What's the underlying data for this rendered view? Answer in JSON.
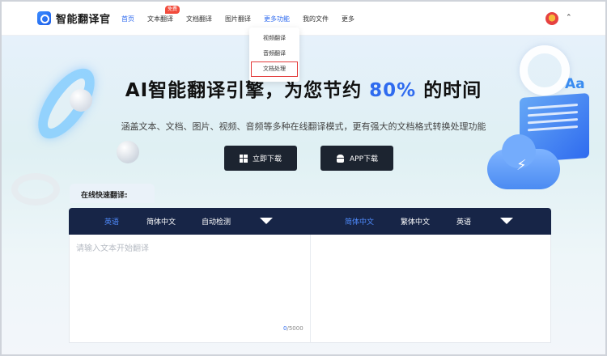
{
  "header": {
    "logo_text": "智能翻译官",
    "nav": [
      {
        "label": "首页"
      },
      {
        "label": "文本翻译",
        "badge": "免费"
      },
      {
        "label": "文档翻译"
      },
      {
        "label": "图片翻译"
      },
      {
        "label": "更多功能"
      },
      {
        "label": "我的文件"
      },
      {
        "label": "更多"
      }
    ],
    "active_nav": "首页",
    "expanded_nav": "更多功能"
  },
  "dropdown": {
    "items": [
      "视频翻译",
      "音频翻译",
      "文档处理"
    ],
    "highlighted": "文档处理"
  },
  "hero": {
    "title_before": "AI智能翻译引擎，为您节约 ",
    "title_highlight": "80%",
    "title_after": " 的时间",
    "subtitle": "涵盖文本、文档、图片、视频、音频等多种在线翻译模式，更有强大的文档格式转换处理功能",
    "download_button": "立即下载",
    "app_button": "APP下载",
    "deco_text": "Aa"
  },
  "translator": {
    "tab_label": "在线快速翻译:",
    "source_langs": [
      "英语",
      "简体中文",
      "自动检测"
    ],
    "source_active": "英语",
    "target_langs": [
      "简体中文",
      "繁体中文",
      "英语"
    ],
    "target_active": "简体中文",
    "input_value": "",
    "input_placeholder": "请输入文本开始翻译",
    "char_count": "0",
    "char_limit": "/5000"
  },
  "colors": {
    "accent": "#2f6bef",
    "lang_bar": "#172547",
    "badge": "#f24b3c",
    "button": "#1c2430"
  }
}
